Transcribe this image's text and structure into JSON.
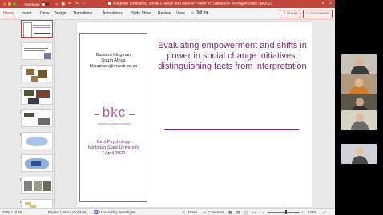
{
  "window": {
    "autosave_label": "AutoSave",
    "autosave_state": "OFF",
    "title": "Klugman Evaluating Social Change and uses of Power in Evaluation- Michigan State Apr2022",
    "title_prefix_icon": "powerpoint-icon"
  },
  "ribbon": {
    "tabs": [
      "Home",
      "Insert",
      "Draw",
      "Design",
      "Transitions",
      "Animations",
      "Slide Show",
      "Review",
      "View"
    ],
    "active_tab": "Home",
    "tell_me": "Tell me",
    "share": "Share",
    "comments": "Comments",
    "accent_color": "#c0463a"
  },
  "thumbnails": {
    "numbers": [
      "1",
      "2",
      "3",
      "4",
      "5",
      "6",
      "7",
      "8",
      "9"
    ],
    "selected": "1"
  },
  "slide": {
    "author_name": "Barbara Klugman",
    "author_country": "South Africa",
    "author_email": "bklugman@mweb.co.za",
    "logo_text": "bkc",
    "logo_caption": "BARBARA KLUGMAN CONCEPTS",
    "dept": "Dept Psychology",
    "university": "Michigan State University",
    "date": "7 April 2022",
    "title": "Evaluating empowerment and shifts in power in social change initiatives: distinguishing facts from interpretation",
    "accent_color": "#7a2e7a"
  },
  "status": {
    "slide_counter": "Slide 1 of 19",
    "language": "English (United Kingdom)",
    "accessibility": "Accessibility: Investigate",
    "notes": "Notes",
    "comments": "Comments",
    "zoom": "124%"
  }
}
